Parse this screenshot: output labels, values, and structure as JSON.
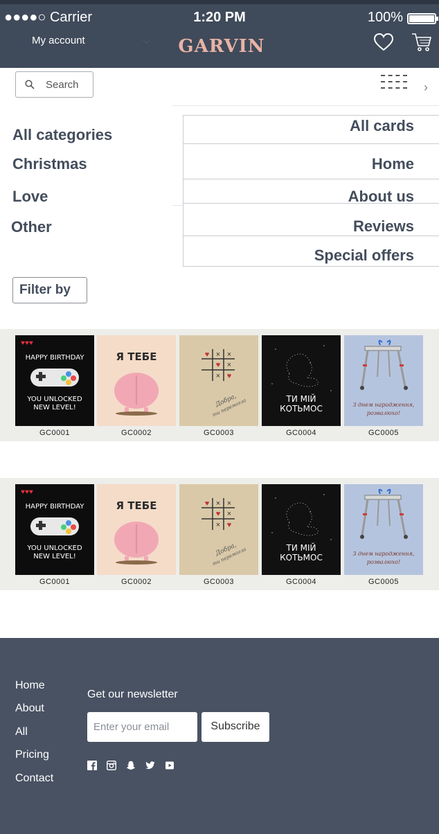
{
  "status_bar": {
    "carrier": "●●●●○ Carrier",
    "time": "1:20 PM",
    "battery": "100%"
  },
  "header": {
    "account": "My account",
    "brand": "GARVIN",
    "brand_color": "#e8b3a6",
    "bg_color": "#3f4a5a"
  },
  "search": {
    "placeholder": "Search"
  },
  "categories": [
    "All categories",
    "Christmas",
    "Love",
    "Other"
  ],
  "nav": [
    "All cards",
    "Home",
    "About us",
    "Reviews",
    "Special offers"
  ],
  "filter": {
    "label": "Filter by"
  },
  "cards": [
    {
      "code": "GC0001",
      "text": [
        "HAPPY BIRTHDAY",
        "YOU UNLOCKED",
        "NEW LEVEL!"
      ]
    },
    {
      "code": "GC0002",
      "text": [
        "Я ТЕБЕ"
      ]
    },
    {
      "code": "GC0003",
      "text": [
        "Добра,",
        "ти перемогла"
      ]
    },
    {
      "code": "GC0004",
      "text": [
        "ТИ МІЙ",
        "КОТЬМОС"
      ]
    },
    {
      "code": "GC0005",
      "text": [
        "З днем народження,",
        "розвалюхо!"
      ]
    }
  ],
  "footer": {
    "links": [
      "Home",
      "About",
      "All",
      "Pricing",
      "Contact"
    ],
    "newsletter": "Get our newsletter",
    "email_placeholder": "Enter your email",
    "subscribe": "Subscribe",
    "social": [
      "facebook-icon",
      "instagram-icon",
      "snapchat-icon",
      "twitter-icon",
      "youtube-icon"
    ],
    "bg_color": "#485262"
  }
}
